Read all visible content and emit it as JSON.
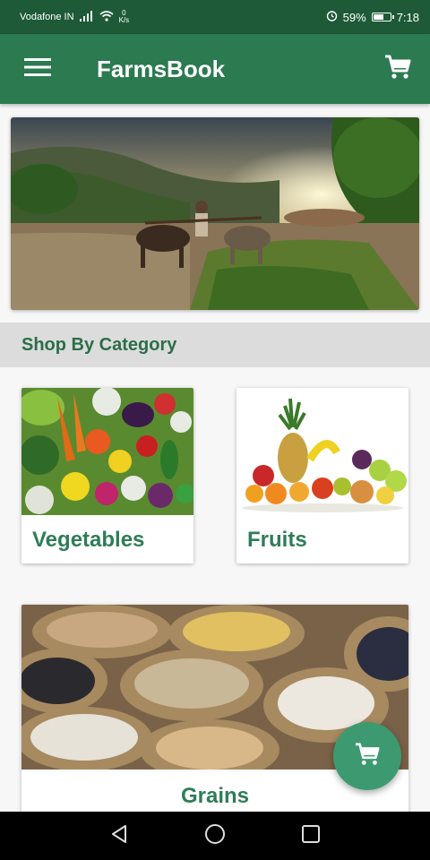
{
  "status_bar": {
    "carrier": "Vodafone IN",
    "speed_value": "0",
    "speed_unit": "K/s",
    "battery": "59%",
    "time": "7:18",
    "battery_level": 0.59
  },
  "app_bar": {
    "title": "FarmsBook",
    "menu_icon": "hamburger-menu-icon",
    "cart_icon": "shopping-cart-icon"
  },
  "hero": {
    "image": "farmer-plowing-field-with-oxen-sunset"
  },
  "section": {
    "title": "Shop By Category"
  },
  "categories": [
    {
      "label": "Vegetables",
      "image": "vegetables-assortment"
    },
    {
      "label": "Fruits",
      "image": "fruits-assortment"
    },
    {
      "label": "Grains",
      "image": "grain-sacks"
    }
  ],
  "fab": {
    "icon": "shopping-cart-icon"
  },
  "nav_bar": {
    "icons": [
      "back-triangle-icon",
      "home-circle-icon",
      "recents-square-icon"
    ]
  },
  "colors": {
    "status_bar": "#1e5a38",
    "app_bar": "#2b7a50",
    "accent": "#2f7d57",
    "fab": "#3d9a70"
  }
}
